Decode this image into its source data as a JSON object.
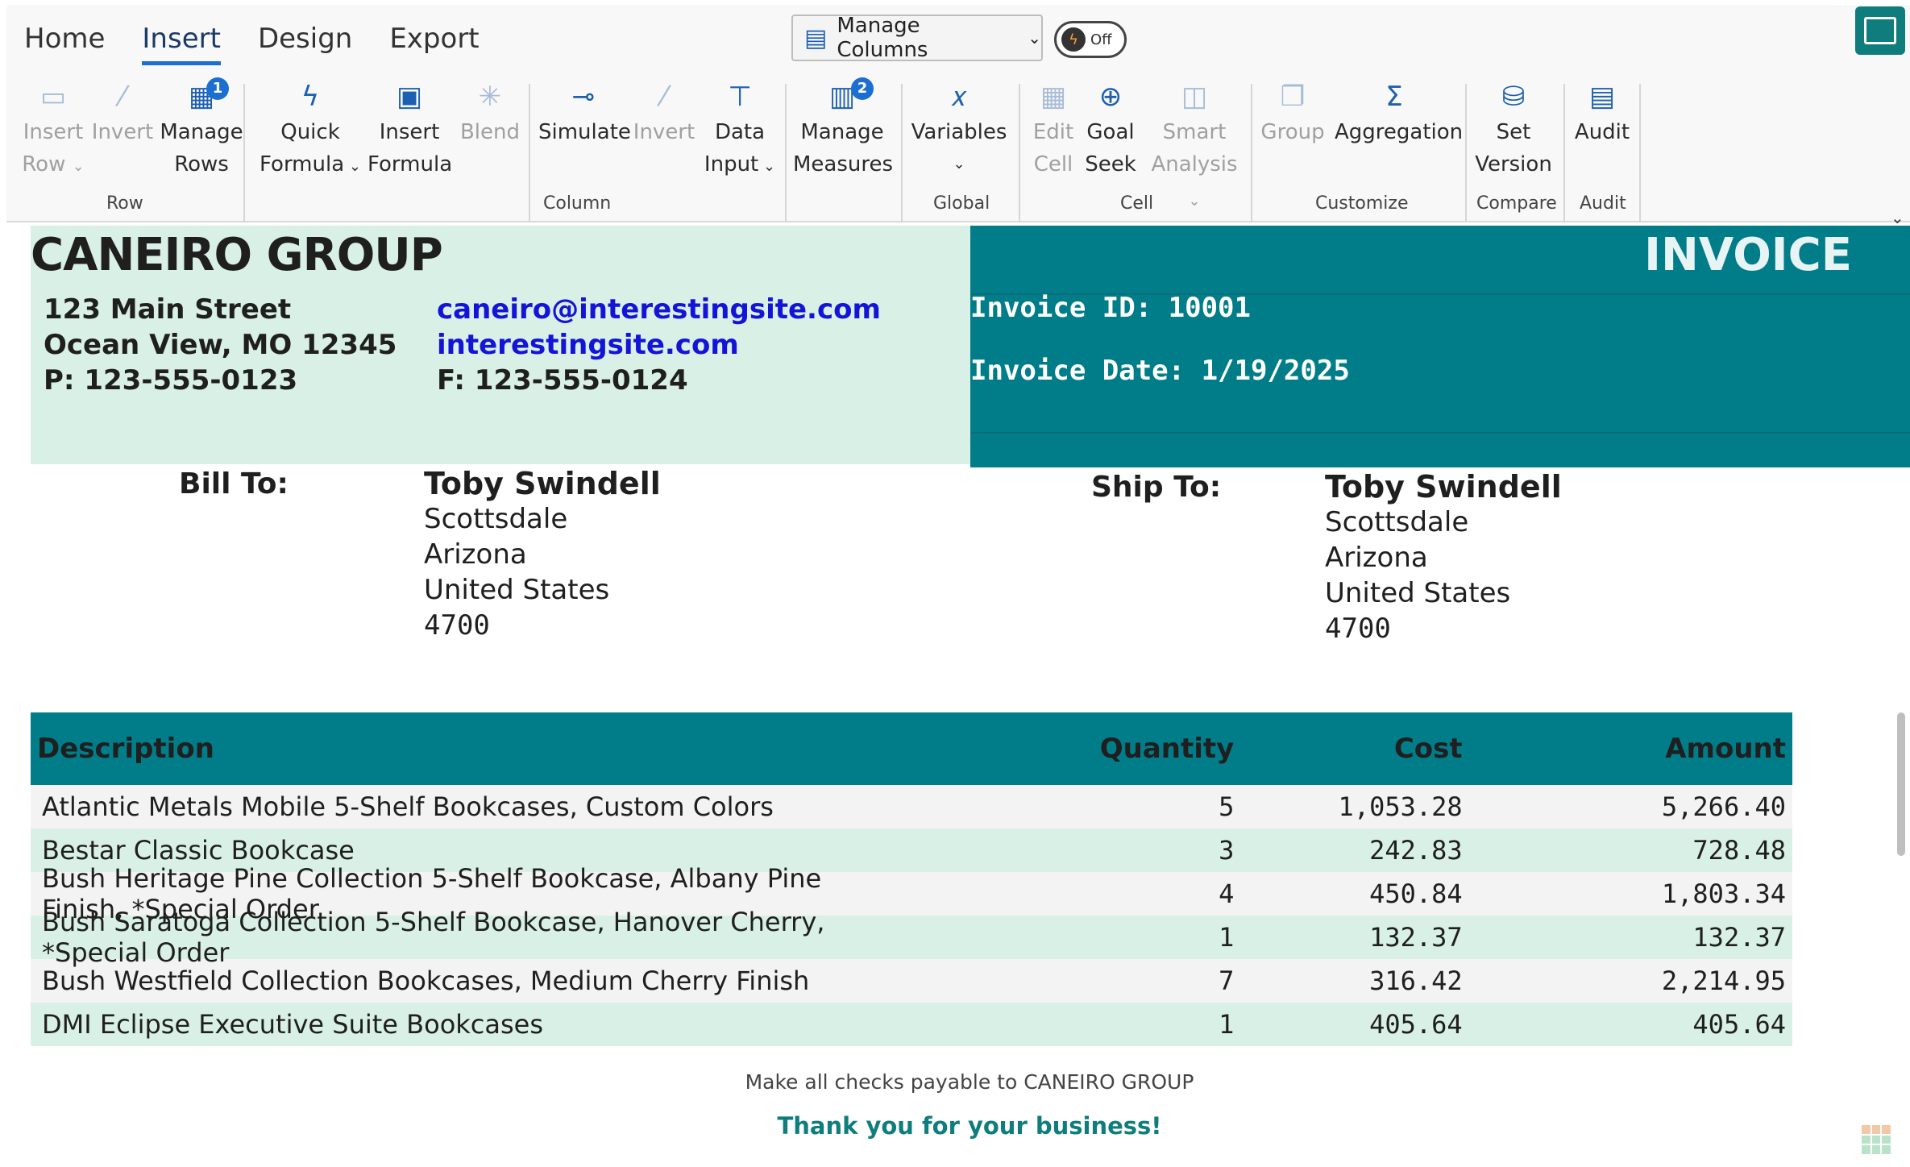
{
  "ribbon": {
    "tabs": [
      "Home",
      "Insert",
      "Design",
      "Export"
    ],
    "active_tab": "Insert",
    "manage_columns": "Manage Columns",
    "toggle": "Off",
    "commands": {
      "insert_row": [
        "Insert",
        "Row"
      ],
      "invert_row": "Invert",
      "manage_rows": [
        "Manage",
        "Rows"
      ],
      "manage_rows_badge": "1",
      "quick_formula": [
        "Quick",
        "Formula"
      ],
      "insert_formula": [
        "Insert",
        "Formula"
      ],
      "blend": "Blend",
      "simulate": "Simulate",
      "invert_col": "Invert",
      "data_input": [
        "Data",
        "Input"
      ],
      "manage_measures": [
        "Manage",
        "Measures"
      ],
      "manage_measures_badge": "2",
      "variables": "Variables",
      "edit_cell": [
        "Edit",
        "Cell"
      ],
      "goal_seek": [
        "Goal",
        "Seek"
      ],
      "smart_analysis": [
        "Smart",
        "Analysis"
      ],
      "group": "Group",
      "aggregation": "Aggregation",
      "set_version": [
        "Set",
        "Version"
      ],
      "audit": "Audit"
    },
    "groups": {
      "row": "Row",
      "column": "Column",
      "global": "Global",
      "cell": "Cell",
      "customize": "Customize",
      "compare": "Compare",
      "audit": "Audit"
    }
  },
  "invoice": {
    "company": "CANEIRO GROUP",
    "address": [
      "123 Main Street",
      "Ocean View, MO 12345",
      "P: 123-555-0123"
    ],
    "email": "caneiro@interestingsite.com",
    "website": "interestingsite.com",
    "fax": "F: 123-555-0124",
    "title": "INVOICE",
    "invoice_id": "Invoice ID: 10001",
    "invoice_date": "Invoice Date: 1/19/2025",
    "bill_to_label": "Bill To:",
    "ship_to_label": "Ship To:",
    "bill_to": {
      "name": "Toby Swindell",
      "city": "Scottsdale",
      "state": "Arizona",
      "country": "United States",
      "zip": "4700"
    },
    "ship_to": {
      "name": "Toby Swindell",
      "city": "Scottsdale",
      "state": "Arizona",
      "country": "United States",
      "zip": "4700"
    },
    "table": {
      "headers": {
        "description": "Description",
        "quantity": "Quantity",
        "cost": "Cost",
        "amount": "Amount"
      },
      "rows": [
        {
          "description": "Atlantic Metals Mobile 5-Shelf Bookcases, Custom Colors",
          "quantity": "5",
          "cost": "1,053.28",
          "amount": "5,266.40"
        },
        {
          "description": "Bestar Classic Bookcase",
          "quantity": "3",
          "cost": "242.83",
          "amount": "728.48"
        },
        {
          "description": "Bush Heritage Pine Collection 5-Shelf Bookcase, Albany Pine Finish, *Special Order",
          "quantity": "4",
          "cost": "450.84",
          "amount": "1,803.34"
        },
        {
          "description": "Bush Saratoga Collection 5-Shelf Bookcase, Hanover Cherry, *Special Order",
          "quantity": "1",
          "cost": "132.37",
          "amount": "132.37"
        },
        {
          "description": "Bush Westfield Collection Bookcases, Medium Cherry Finish",
          "quantity": "7",
          "cost": "316.42",
          "amount": "2,214.95"
        },
        {
          "description": "DMI Eclipse Executive Suite Bookcases",
          "quantity": "1",
          "cost": "405.64",
          "amount": "405.64"
        }
      ]
    },
    "checks_note": "Make all checks payable to CANEIRO GROUP",
    "thanks": "Thank you for your business!"
  },
  "colors": {
    "accent_teal": "#017d8a",
    "light_green": "#d8f0e6",
    "link_blue": "#1414d8",
    "ribbon_icon_blue": "#1d5fb0"
  }
}
